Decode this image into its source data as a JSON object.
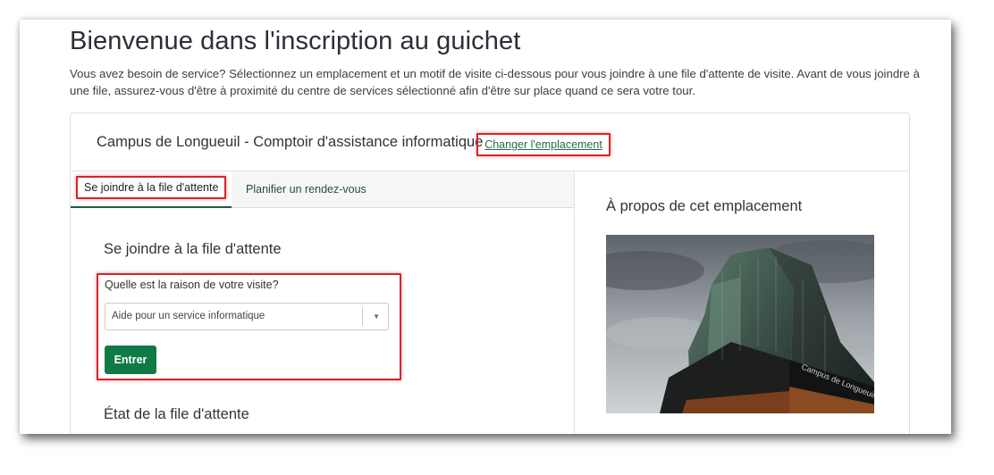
{
  "page": {
    "title": "Bienvenue dans l'inscription au guichet",
    "intro": "Vous avez besoin de service? Sélectionnez un emplacement et un motif de visite ci-dessous pour vous joindre à une file d'attente de visite. Avant de vous joindre à une file, assurez-vous d'être à proximité du centre de services sélectionné afin d'être sur place quand ce sera votre tour."
  },
  "location": {
    "name": "Campus de Longueuil - Comptoir d'assistance informatique",
    "change_link": "Changer l'emplacement"
  },
  "tabs": [
    {
      "label": "Se joindre à la file d'attente",
      "active": true
    },
    {
      "label": "Planifier un rendez-vous",
      "active": false
    }
  ],
  "join_form": {
    "heading": "Se joindre à la file d'attente",
    "question_label": "Quelle est la raison de votre visite?",
    "selected_reason": "Aide pour un service informatique",
    "submit_label": "Entrer"
  },
  "queue_status": {
    "heading": "État de la file d'attente"
  },
  "about": {
    "heading": "À propos de cet emplacement",
    "photo_sign_text": "Campus de Longueuil"
  },
  "colors": {
    "accent_green": "#0f7a46",
    "link_green": "#1f6e4c",
    "highlight_red": "#d9222a"
  }
}
